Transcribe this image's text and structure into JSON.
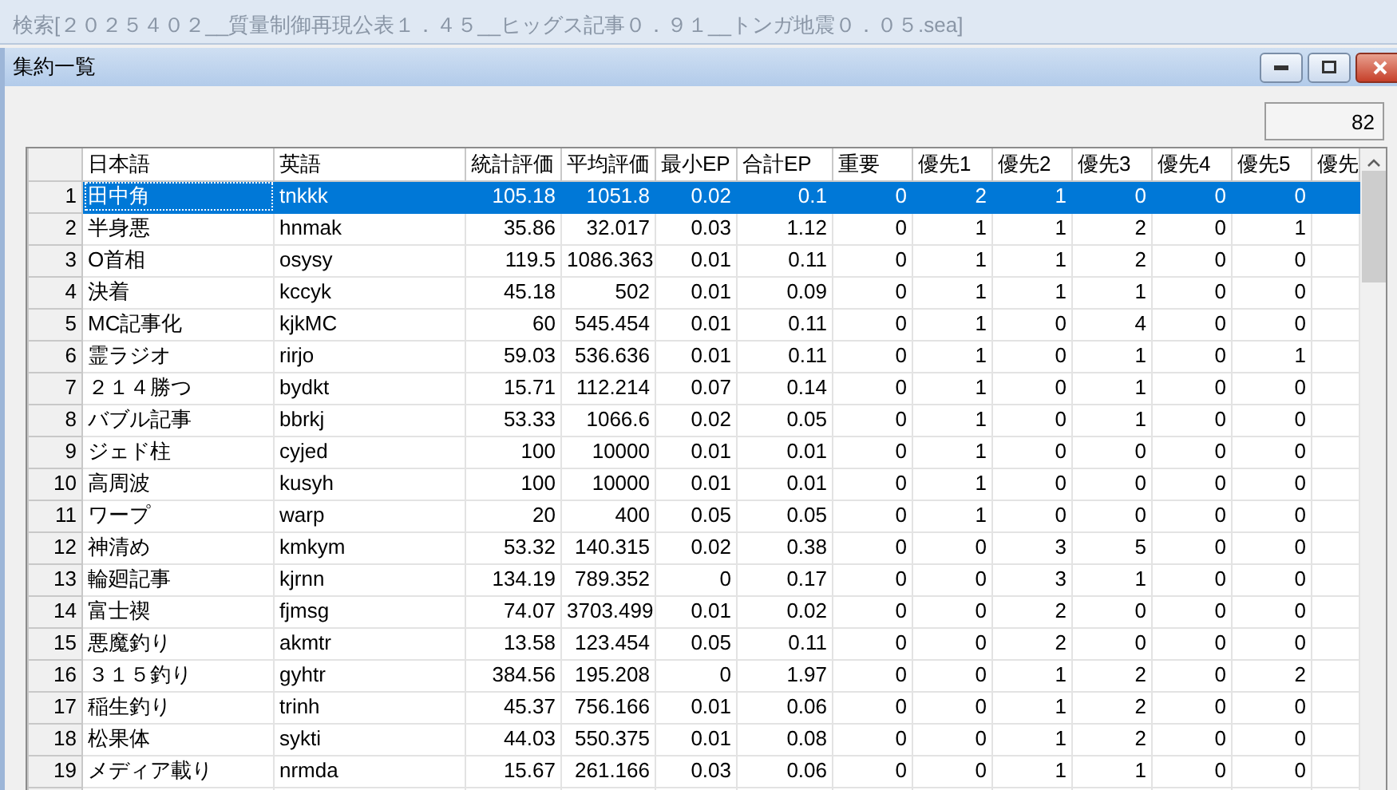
{
  "parent_window": {
    "title": "検索[２０２５４０２__質量制御再現公表１．４５__ヒッグス記事０．９１__トンガ地震０．０５.sea]"
  },
  "window": {
    "title": "集約一覧",
    "buttons": [
      {
        "kind": "minimize"
      },
      {
        "kind": "maximize"
      },
      {
        "kind": "close"
      }
    ]
  },
  "count": "82",
  "table": {
    "columns": [
      "日本語",
      "英語",
      "統計評価",
      "平均評価",
      "最小EP",
      "合計EP",
      "重要",
      "優先1",
      "優先2",
      "優先3",
      "優先4",
      "優先5",
      "優先"
    ],
    "rows": [
      {
        "number": "1",
        "selected": true,
        "cells": [
          "田中角",
          "tnkkk",
          "105.18",
          "1051.8",
          "0.02",
          "0.1",
          "0",
          "2",
          "1",
          "0",
          "0",
          "0"
        ]
      },
      {
        "number": "2",
        "selected": false,
        "cells": [
          "半身悪",
          "hnmak",
          "35.86",
          "32.017",
          "0.03",
          "1.12",
          "0",
          "1",
          "1",
          "2",
          "0",
          "1"
        ]
      },
      {
        "number": "3",
        "selected": false,
        "cells": [
          "O首相",
          "osysy",
          "119.5",
          "1086.363",
          "0.01",
          "0.11",
          "0",
          "1",
          "1",
          "2",
          "0",
          "0"
        ]
      },
      {
        "number": "4",
        "selected": false,
        "cells": [
          "決着",
          "kccyk",
          "45.18",
          "502",
          "0.01",
          "0.09",
          "0",
          "1",
          "1",
          "1",
          "0",
          "0"
        ]
      },
      {
        "number": "5",
        "selected": false,
        "cells": [
          "MC記事化",
          "kjkMC",
          "60",
          "545.454",
          "0.01",
          "0.11",
          "0",
          "1",
          "0",
          "4",
          "0",
          "0"
        ]
      },
      {
        "number": "6",
        "selected": false,
        "cells": [
          "霊ラジオ",
          "rirjo",
          "59.03",
          "536.636",
          "0.01",
          "0.11",
          "0",
          "1",
          "0",
          "1",
          "0",
          "1"
        ]
      },
      {
        "number": "7",
        "selected": false,
        "cells": [
          "２１４勝つ",
          "bydkt",
          "15.71",
          "112.214",
          "0.07",
          "0.14",
          "0",
          "1",
          "0",
          "1",
          "0",
          "0"
        ]
      },
      {
        "number": "8",
        "selected": false,
        "cells": [
          "バブル記事",
          "bbrkj",
          "53.33",
          "1066.6",
          "0.02",
          "0.05",
          "0",
          "1",
          "0",
          "1",
          "0",
          "0"
        ]
      },
      {
        "number": "9",
        "selected": false,
        "cells": [
          "ジェド柱",
          "cyjed",
          "100",
          "10000",
          "0.01",
          "0.01",
          "0",
          "1",
          "0",
          "0",
          "0",
          "0"
        ]
      },
      {
        "number": "10",
        "selected": false,
        "cells": [
          "高周波",
          "kusyh",
          "100",
          "10000",
          "0.01",
          "0.01",
          "0",
          "1",
          "0",
          "0",
          "0",
          "0"
        ]
      },
      {
        "number": "11",
        "selected": false,
        "cells": [
          "ワープ",
          "warp",
          "20",
          "400",
          "0.05",
          "0.05",
          "0",
          "1",
          "0",
          "0",
          "0",
          "0"
        ]
      },
      {
        "number": "12",
        "selected": false,
        "cells": [
          "神清め",
          "kmkym",
          "53.32",
          "140.315",
          "0.02",
          "0.38",
          "0",
          "0",
          "3",
          "5",
          "0",
          "0"
        ]
      },
      {
        "number": "13",
        "selected": false,
        "cells": [
          "輪廻記事",
          "kjrnn",
          "134.19",
          "789.352",
          "0",
          "0.17",
          "0",
          "0",
          "3",
          "1",
          "0",
          "0"
        ]
      },
      {
        "number": "14",
        "selected": false,
        "cells": [
          "富士禊",
          "fjmsg",
          "74.07",
          "3703.499",
          "0.01",
          "0.02",
          "0",
          "0",
          "2",
          "0",
          "0",
          "0"
        ]
      },
      {
        "number": "15",
        "selected": false,
        "cells": [
          "悪魔釣り",
          "akmtr",
          "13.58",
          "123.454",
          "0.05",
          "0.11",
          "0",
          "0",
          "2",
          "0",
          "0",
          "0"
        ]
      },
      {
        "number": "16",
        "selected": false,
        "cells": [
          "３１５釣り",
          "gyhtr",
          "384.56",
          "195.208",
          "0",
          "1.97",
          "0",
          "0",
          "1",
          "2",
          "0",
          "2"
        ]
      },
      {
        "number": "17",
        "selected": false,
        "cells": [
          "稲生釣り",
          "trinh",
          "45.37",
          "756.166",
          "0.01",
          "0.06",
          "0",
          "0",
          "1",
          "2",
          "0",
          "0"
        ]
      },
      {
        "number": "18",
        "selected": false,
        "cells": [
          "松果体",
          "sykti",
          "44.03",
          "550.375",
          "0.01",
          "0.08",
          "0",
          "0",
          "1",
          "2",
          "0",
          "0"
        ]
      },
      {
        "number": "19",
        "selected": false,
        "cells": [
          "メディア載り",
          "nrmda",
          "15.67",
          "261.166",
          "0.03",
          "0.06",
          "0",
          "0",
          "1",
          "1",
          "0",
          "0"
        ]
      }
    ]
  }
}
